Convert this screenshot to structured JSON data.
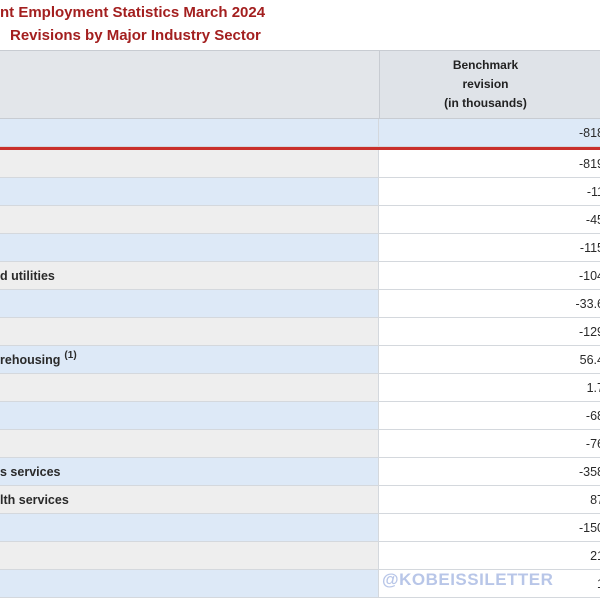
{
  "title": {
    "line1": "nt Employment Statistics March 2024",
    "line2": "Revisions by Major Industry Sector"
  },
  "header": {
    "col_label": "",
    "col_value_line1": "Benchmark",
    "col_value_line2": "revision",
    "col_value_line3": "(in thousands)"
  },
  "total_row": {
    "label": "",
    "value": "-818"
  },
  "rows": [
    {
      "label": "",
      "note": "",
      "value": "-819",
      "shade": "gray"
    },
    {
      "label": "",
      "note": "",
      "value": "-11",
      "shade": "blue"
    },
    {
      "label": "",
      "note": "",
      "value": "-45",
      "shade": "gray"
    },
    {
      "label": "",
      "note": "",
      "value": "-115",
      "shade": "blue"
    },
    {
      "label": "d utilities",
      "note": "",
      "value": "-104",
      "shade": "gray"
    },
    {
      "label": "",
      "note": "",
      "value": "-33.6",
      "shade": "blue"
    },
    {
      "label": "",
      "note": "",
      "value": "-129",
      "shade": "gray"
    },
    {
      "label": "rehousing",
      "note": "(1)",
      "value": "56.4",
      "shade": "blue"
    },
    {
      "label": "",
      "note": "",
      "value": "1.7",
      "shade": "gray"
    },
    {
      "label": "",
      "note": "",
      "value": "-68",
      "shade": "blue"
    },
    {
      "label": "",
      "note": "",
      "value": "-76",
      "shade": "gray"
    },
    {
      "label": "s services",
      "note": "",
      "value": "-358",
      "shade": "blue"
    },
    {
      "label": "lth services",
      "note": "",
      "value": "87",
      "shade": "gray"
    },
    {
      "label": "",
      "note": "",
      "value": "-150",
      "shade": "blue"
    },
    {
      "label": "",
      "note": "",
      "value": "21",
      "shade": "gray"
    },
    {
      "label": "",
      "note": "",
      "value": "1",
      "shade": "blue"
    }
  ],
  "watermark": "@KOBEISSILETTER"
}
